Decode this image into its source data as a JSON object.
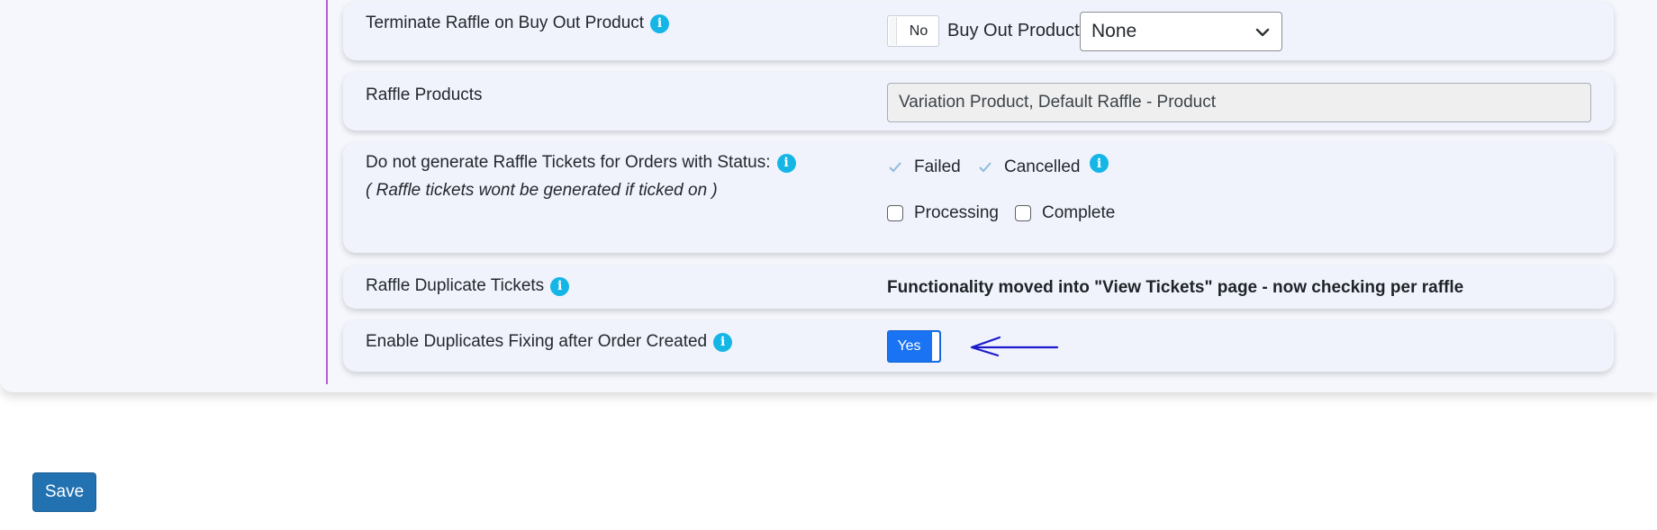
{
  "settings": {
    "terminate": {
      "label": "Terminate Raffle on Buy Out Product",
      "toggle": "No",
      "buyout_label": "Buy Out Product",
      "buyout_value": "None"
    },
    "products": {
      "label": "Raffle Products",
      "value": "Variation Product, Default Raffle - Product"
    },
    "status": {
      "label": "Do not generate Raffle Tickets for Orders with Status:",
      "sublabel": "( Raffle tickets wont be generated if ticked on )",
      "options": [
        {
          "label": "Failed",
          "checked": true
        },
        {
          "label": "Cancelled",
          "checked": true
        },
        {
          "label": "Processing",
          "checked": false
        },
        {
          "label": "Complete",
          "checked": false
        }
      ]
    },
    "duplicates": {
      "label": "Raffle Duplicate Tickets",
      "note": "Functionality moved into \"View Tickets\" page - now checking per raffle"
    },
    "fixing": {
      "label": "Enable Duplicates Fixing after Order Created",
      "toggle": "Yes"
    }
  },
  "info_icon": "i",
  "save_label": "Save",
  "colors": {
    "info": "#15b6e6",
    "toggle_on": "#1a73f2",
    "save": "#2271b1",
    "annotation_arrow": "#1a1acc",
    "divider": "#b35cd6"
  }
}
